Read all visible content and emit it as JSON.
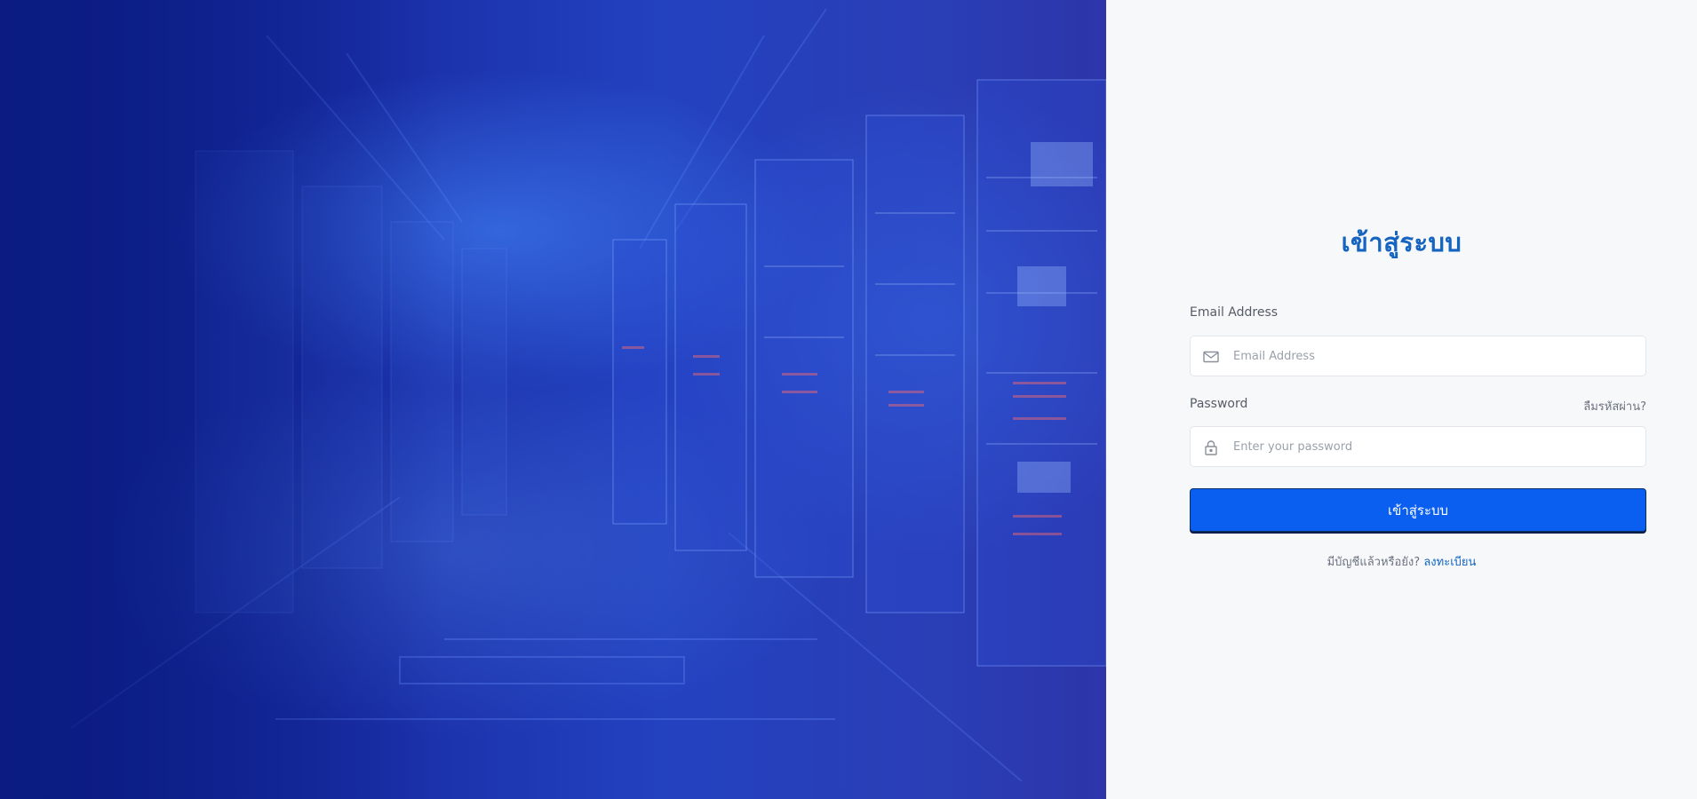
{
  "hero": {
    "background_image": "server-room-illustration",
    "colors": {
      "deep_blue": "#0b1e86",
      "mid_blue": "#2342c0",
      "glow": "#4a8cff"
    }
  },
  "login": {
    "title": "เข้าสู่ระบบ",
    "email_label": "Email Address",
    "email_placeholder": "Email Address",
    "email_value": "",
    "email_icon": "envelope-icon",
    "password_label": "Password",
    "password_placeholder": "Enter your password",
    "password_value": "",
    "password_icon": "lock-icon",
    "forgot_label": "ลืมรหัสผ่าน?",
    "submit_label": "เข้าสู่ระบบ",
    "register_prompt": "มีบัญชีแล้วหรือยัง?",
    "register_link": "ลงทะเบียน"
  },
  "colors": {
    "accent": "#1565c0",
    "button": "#0a5ff0",
    "panel_bg": "#f7f8fa"
  }
}
